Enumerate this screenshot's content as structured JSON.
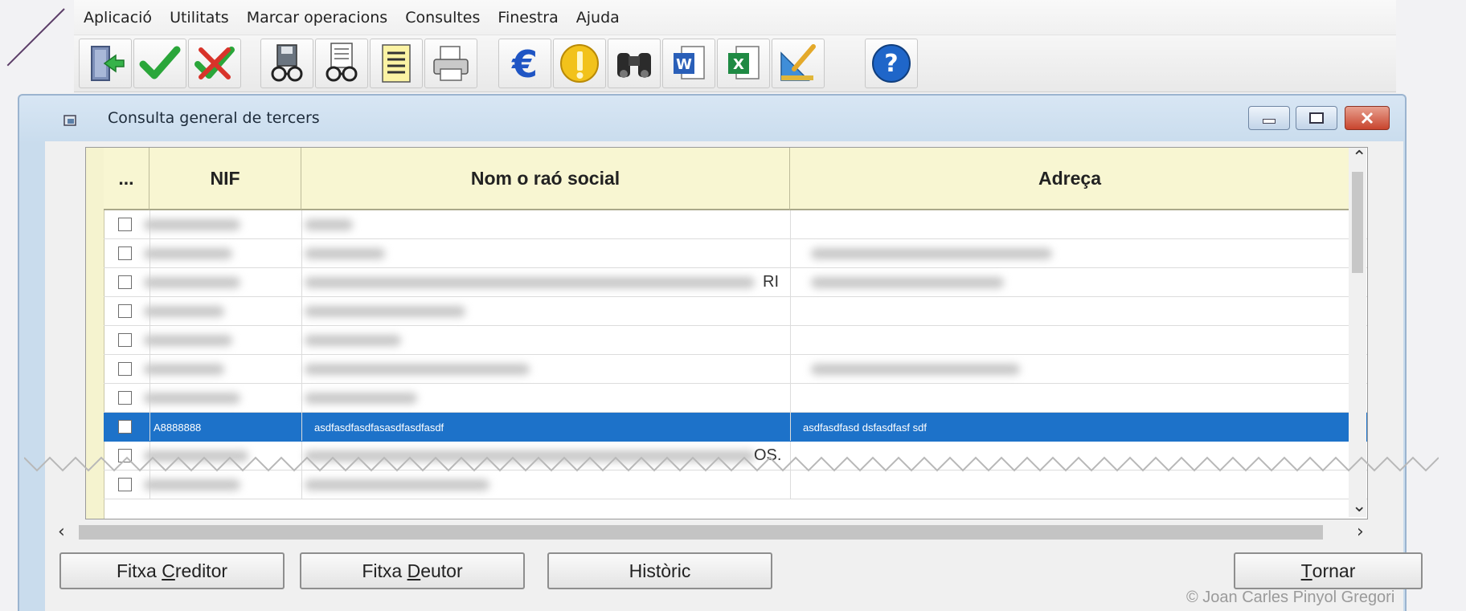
{
  "menu": [
    "Aplicació",
    "Utilitats",
    "Marcar operacions",
    "Consultes",
    "Finestra",
    "Ajuda"
  ],
  "toolbar": {
    "buttons": [
      {
        "icon": "exit-door-icon"
      },
      {
        "icon": "checkmark-icon"
      },
      {
        "icon": "cancel-check-icon"
      },
      {
        "icon": "save-preview-icon"
      },
      {
        "icon": "document-preview-icon"
      },
      {
        "icon": "notepad-list-icon"
      },
      {
        "icon": "printer-icon"
      },
      {
        "icon": "euro-icon"
      },
      {
        "icon": "info-coin-icon"
      },
      {
        "icon": "binoculars-icon"
      },
      {
        "icon": "word-export-icon"
      },
      {
        "icon": "excel-export-icon"
      },
      {
        "icon": "ruler-edit-icon"
      },
      {
        "icon": "help-icon"
      }
    ]
  },
  "window": {
    "title": "Consulta general de tercers"
  },
  "grid": {
    "columns": [
      "...",
      "NIF",
      "Nom o raó social",
      "Adreça"
    ],
    "rows": [
      {
        "nif": "",
        "name": "",
        "address": "",
        "selected": false
      },
      {
        "nif": "",
        "name": "",
        "address": "",
        "selected": false
      },
      {
        "nif": "",
        "name": "RI",
        "address": "",
        "selected": false
      },
      {
        "nif": "",
        "name": "",
        "address": "",
        "selected": false
      },
      {
        "nif": "",
        "name": "",
        "address": "",
        "selected": false
      },
      {
        "nif": "",
        "name": "",
        "address": "",
        "selected": false
      },
      {
        "nif": "",
        "name": "",
        "address": "",
        "selected": false
      },
      {
        "nif": "A8888888",
        "name": "asdfasdfasdfasasdfasdfasdf",
        "address": "asdfasdfasd dsfasdfasf sdf",
        "selected": true
      },
      {
        "nif": "",
        "name": "OS.",
        "address": "",
        "selected": false
      },
      {
        "nif": "",
        "name": "",
        "address": "",
        "selected": false
      }
    ]
  },
  "buttons": {
    "creditor": {
      "pre": "Fitxa ",
      "hot": "C",
      "post": "reditor"
    },
    "debtor": {
      "pre": "Fitxa ",
      "hot": "D",
      "post": "eutor"
    },
    "history": {
      "pre": "",
      "hot": "",
      "post": "Històric"
    },
    "back": {
      "pre": "",
      "hot": "T",
      "post": "ornar"
    }
  },
  "copyright": "© Joan Carles Pinyol Gregori"
}
